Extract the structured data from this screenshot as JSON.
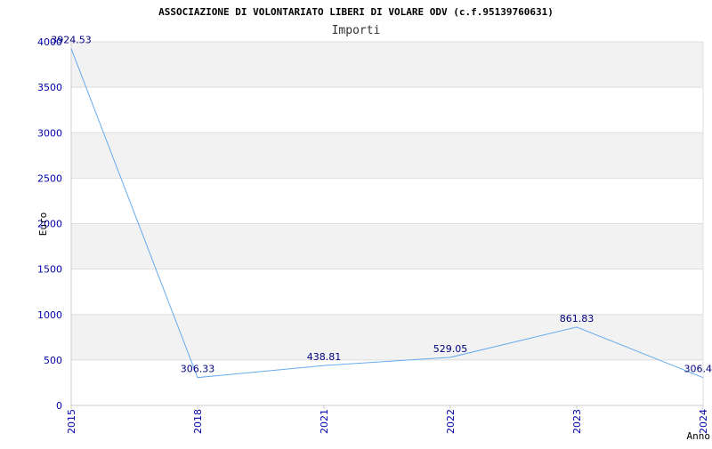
{
  "chart_data": {
    "type": "line",
    "title": "ASSOCIAZIONE DI VOLONTARIATO LIBERI DI VOLARE ODV (c.f.95139760631)",
    "subtitle": "Importi",
    "xlabel": "Anno",
    "ylabel": "Euro",
    "categories": [
      "2015",
      "2018",
      "2021",
      "2022",
      "2023",
      "2024"
    ],
    "series": [
      {
        "values": [
          3924.53,
          306.33,
          438.81,
          529.05,
          861.83,
          306.4
        ],
        "labels": [
          "3924.53",
          "306.33",
          "438.81",
          "529.05",
          "861.83",
          "306.4"
        ],
        "color": "#66aaee"
      }
    ],
    "ylim": [
      0,
      4000
    ],
    "yticks": [
      "0",
      "500",
      "1000",
      "1500",
      "2000",
      "2500",
      "3000",
      "3500",
      "4000"
    ],
    "grid": true,
    "band_colors": [
      "#f2f2f2",
      "#ffffff"
    ],
    "tick_color": "#0000aa",
    "label_color": "#000080"
  }
}
